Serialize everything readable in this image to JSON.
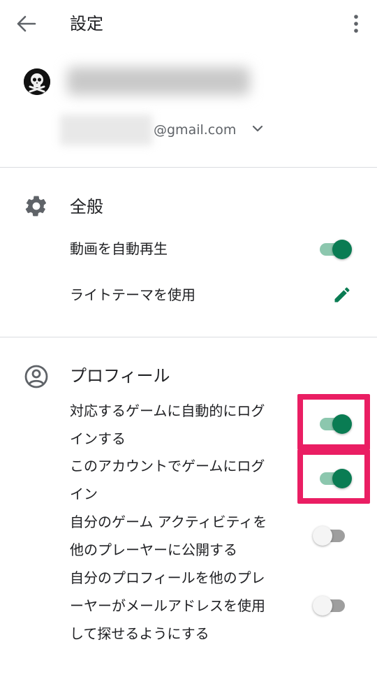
{
  "topbar": {
    "title": "設定",
    "back_icon": "arrow-back-icon",
    "more_icon": "more-vert-icon"
  },
  "account": {
    "email_suffix": "@gmail.com",
    "avatar_icon": "skull-crossbones-icon",
    "expand_icon": "chevron-down-icon"
  },
  "general": {
    "title": "全般",
    "icon": "gear-icon",
    "autoplay_label": "動画を自動再生",
    "autoplay_on": true,
    "light_theme_label": "ライトテーマを使用",
    "light_theme_icon": "pencil-icon"
  },
  "profile": {
    "title": "プロフィール",
    "icon": "account-circle-icon",
    "items": [
      {
        "label_line1": "対応するゲームに自動的にログ",
        "label_line2": "インする",
        "on": true,
        "highlighted": true
      },
      {
        "label_line1": "このアカウントでゲームにログ",
        "label_line2": "イン",
        "on": true,
        "highlighted": true
      },
      {
        "label_line1": "自分のゲーム アクティビティを",
        "label_line2": "他のプレーヤーに公開する",
        "on": false,
        "highlighted": false
      },
      {
        "label_line1": "自分のプロフィールを他のプレ",
        "label_line2": "ーヤーがメールアドレスを使用",
        "label_line3": "して探せるようにする",
        "on": false,
        "highlighted": false
      }
    ]
  },
  "colors": {
    "accent": "#0a7c53",
    "accent_track": "#8cc7ae",
    "highlight": "#ea1e63",
    "divider": "#dadce0"
  }
}
